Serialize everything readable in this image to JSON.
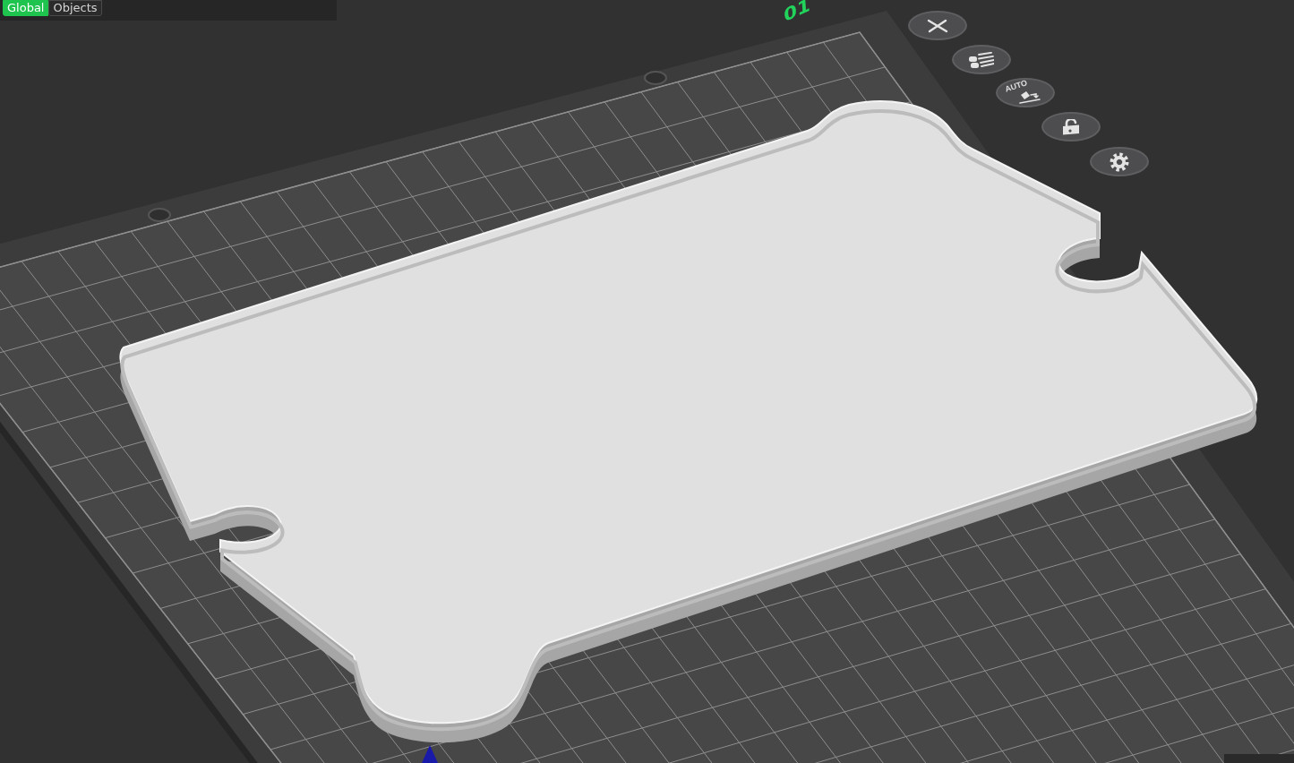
{
  "view_tabs": [
    {
      "label": "Global",
      "selected": true
    },
    {
      "label": "Objects",
      "selected": false
    }
  ],
  "plate": {
    "number": "01"
  },
  "plate_buttons": [
    {
      "kind": "close"
    },
    {
      "kind": "arrange"
    },
    {
      "kind": "auto-orient",
      "label": "AUTO"
    },
    {
      "kind": "lock"
    },
    {
      "kind": "settings"
    }
  ]
}
